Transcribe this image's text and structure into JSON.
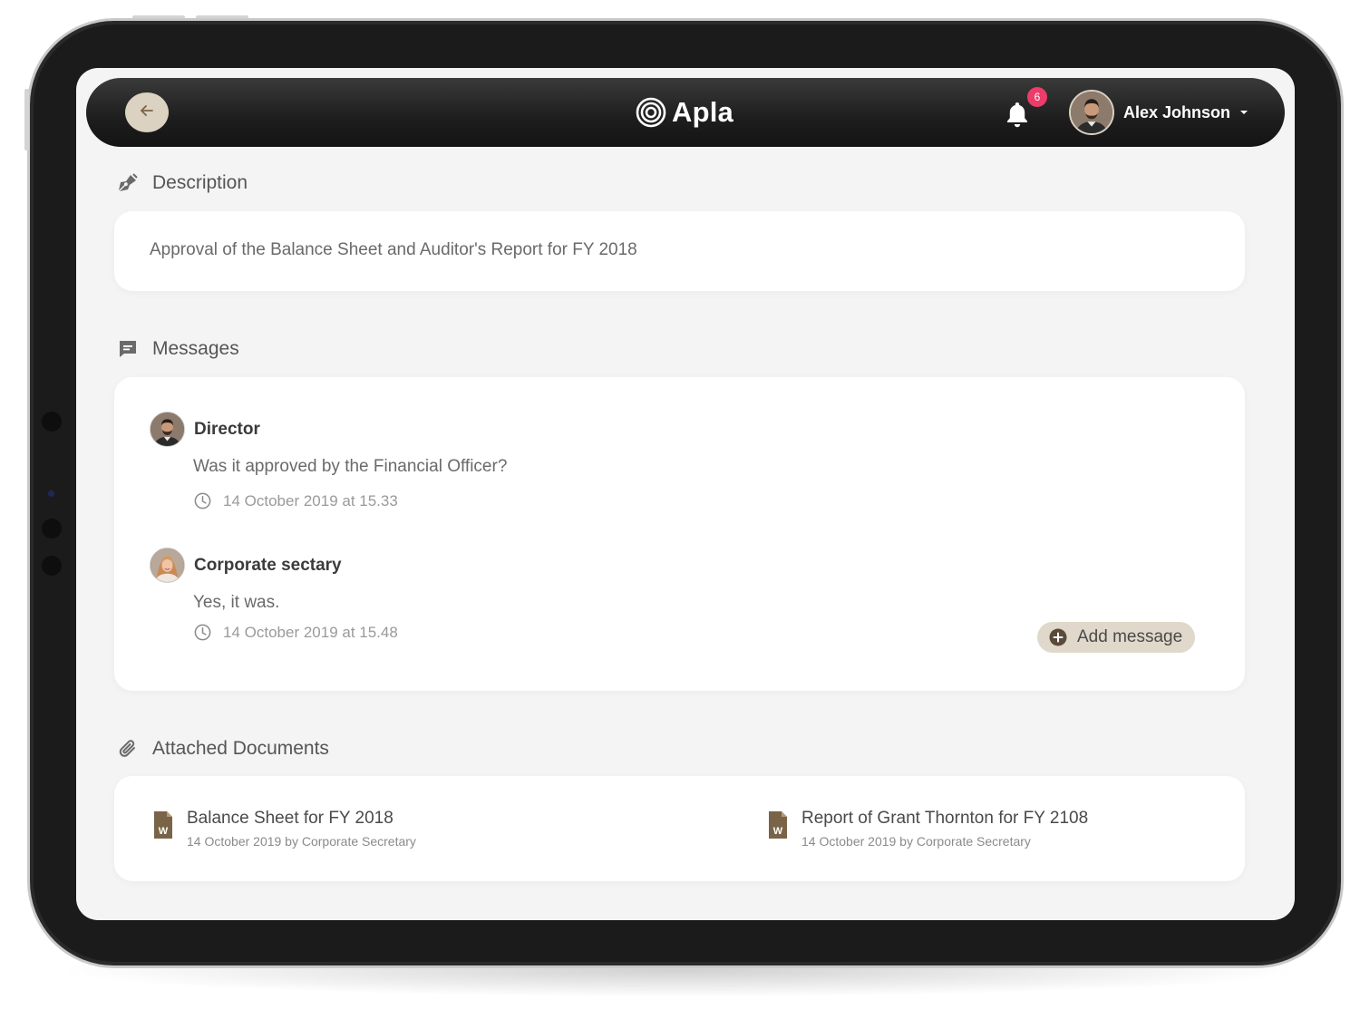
{
  "app": {
    "brand_name": "Apla",
    "notification_count": "6",
    "user_name": "Alex Johnson"
  },
  "description": {
    "section_title": "Description",
    "text": "Approval of the Balance Sheet and Auditor's Report for FY 2018"
  },
  "messages": {
    "section_title": "Messages",
    "items": [
      {
        "author": "Director",
        "text": "Was it approved by the Financial Officer?",
        "time": "14 October 2019 at 15.33"
      },
      {
        "author": "Corporate sectary",
        "text": "Yes, it was.",
        "time": "14 October 2019 at 15.48"
      }
    ],
    "add_label": "Add message"
  },
  "documents": {
    "section_title": "Attached Documents",
    "items": [
      {
        "title": "Balance Sheet for FY 2018",
        "subtitle": "14 October 2019 by Corporate Secretary"
      },
      {
        "title": "Report of Grant Thornton for FY 2108",
        "subtitle": "14 October 2019 by Corporate Secretary"
      }
    ]
  },
  "colors": {
    "accent": "#d9cfbf",
    "badge": "#ee3c6a",
    "doc_icon": "#7a6448",
    "icon_gray": "#6a6a6a"
  },
  "icons": {
    "back": "arrow-left-icon",
    "logo": "concentric-circles-icon",
    "bell": "bell-icon",
    "caret": "caret-down-icon",
    "description": "pen-nib-icon",
    "messages": "chat-bubble-icon",
    "clock": "clock-icon",
    "add": "plus-circle-icon",
    "documents": "paperclip-icon",
    "word_doc": "word-document-icon"
  }
}
